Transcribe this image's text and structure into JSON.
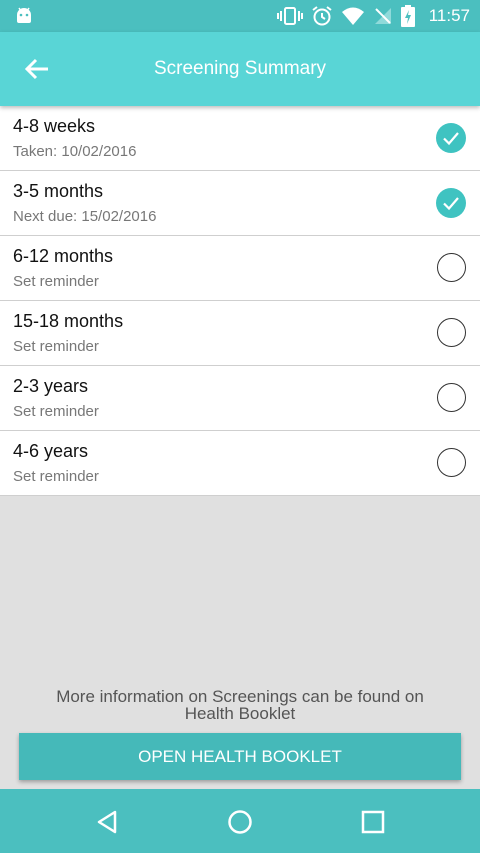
{
  "status_bar": {
    "time": "11:57"
  },
  "header": {
    "title": "Screening Summary"
  },
  "screenings": [
    {
      "title": "4-8 weeks",
      "subtitle": "Taken: 10/02/2016",
      "done": true
    },
    {
      "title": "3-5 months",
      "subtitle": "Next due: 15/02/2016",
      "done": true
    },
    {
      "title": "6-12 months",
      "subtitle": "Set reminder",
      "done": false
    },
    {
      "title": "15-18 months",
      "subtitle": "Set reminder",
      "done": false
    },
    {
      "title": "2-3 years",
      "subtitle": "Set reminder",
      "done": false
    },
    {
      "title": "4-6 years",
      "subtitle": "Set reminder",
      "done": false
    }
  ],
  "footer": {
    "info": "More information on Screenings can be found on Health Booklet",
    "button_label": "OPEN HEALTH BOOKLET"
  },
  "colors": {
    "accent": "#59d5d6",
    "check": "#3fc3c1",
    "button": "#45b9b9"
  }
}
